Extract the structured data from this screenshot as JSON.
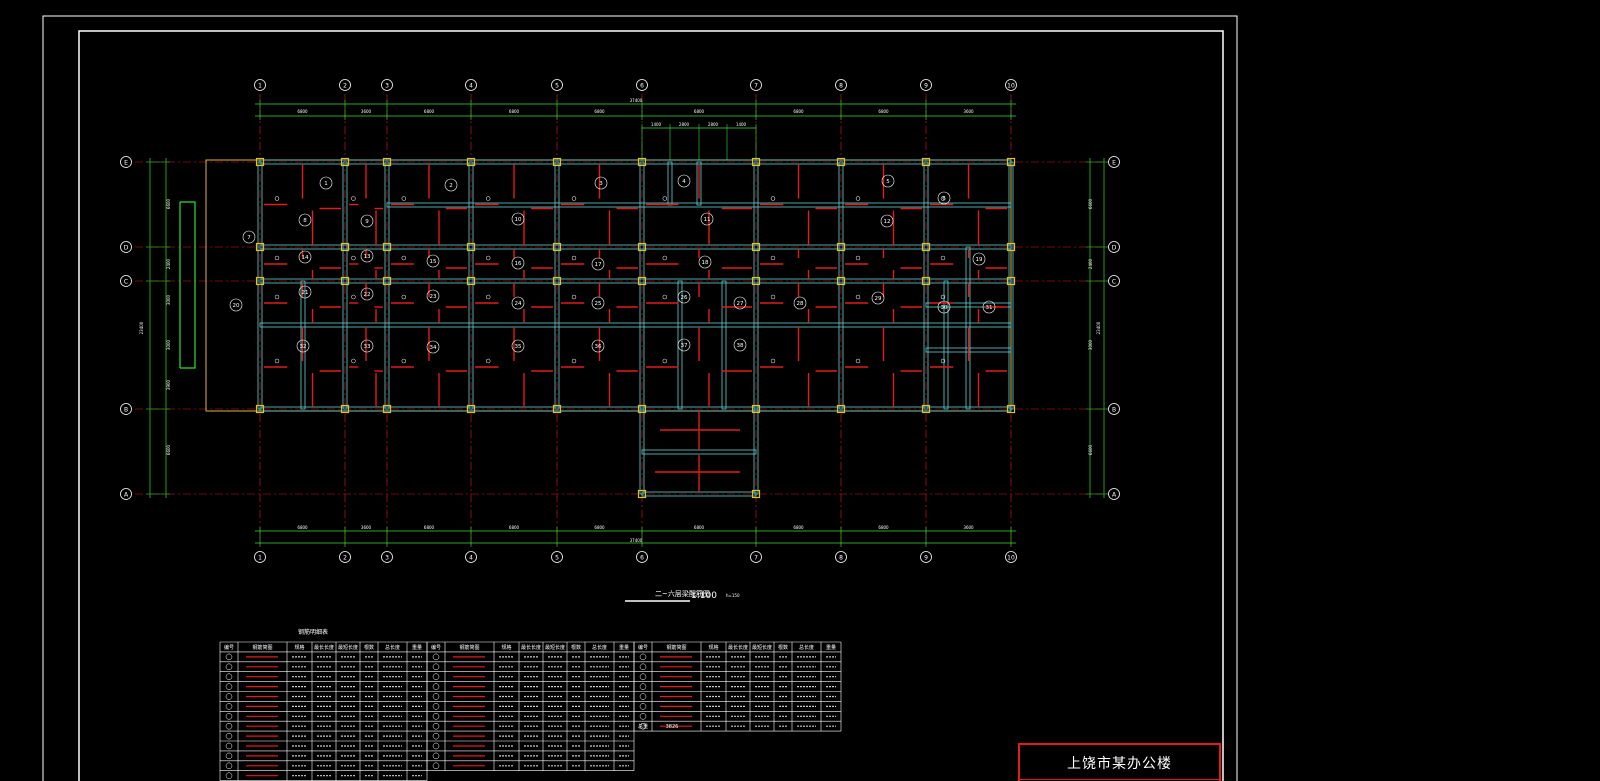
{
  "drawing_title": "二~六层梁配筋图",
  "scale": "1:100",
  "scale_note": "h=150",
  "overall_dimension": "37400",
  "top_dimensions": [
    "6800",
    "3600",
    "6800",
    "6800",
    "6800",
    "6800",
    "6800",
    "6800",
    "3600"
  ],
  "sub_dimensions": [
    "1400",
    "2800",
    "2800",
    "1400"
  ],
  "bottom_dimensions": [
    "6800",
    "3600",
    "6800",
    "6800",
    "6800",
    "6800",
    "6800",
    "6800",
    "3600"
  ],
  "left_dimensions": [
    "6600",
    "2400",
    "3000",
    "3000",
    "3900",
    "6600"
  ],
  "right_dimensions": [
    "6600",
    "2400",
    "3000",
    "6600"
  ],
  "left_total": "23400",
  "right_total": "23400",
  "column_axes": [
    "1",
    "2",
    "3",
    "4",
    "5",
    "6",
    "7",
    "8",
    "9",
    "10"
  ],
  "row_axes": [
    "E",
    "D",
    "C",
    "B",
    "A"
  ],
  "slab_panels": [
    "1",
    "2",
    "3",
    "4",
    "5",
    "6",
    "7",
    "8",
    "9",
    "10",
    "11",
    "12",
    "13",
    "14",
    "15",
    "16",
    "17",
    "18",
    "19",
    "20",
    "21",
    "22",
    "23",
    "24",
    "25",
    "26",
    "27",
    "28",
    "29",
    "30",
    "31",
    "32",
    "33",
    "34",
    "35",
    "36",
    "37",
    "38"
  ],
  "table": {
    "title": "钢筋明细表",
    "headers": [
      "编号",
      "钢筋简图",
      "规格",
      "最长长度",
      "最短长度",
      "根数",
      "总长度",
      "重量"
    ],
    "last_row_label": "总重",
    "total_weight": "3826"
  },
  "title_block": {
    "project_name": "上饶市某办公楼"
  }
}
